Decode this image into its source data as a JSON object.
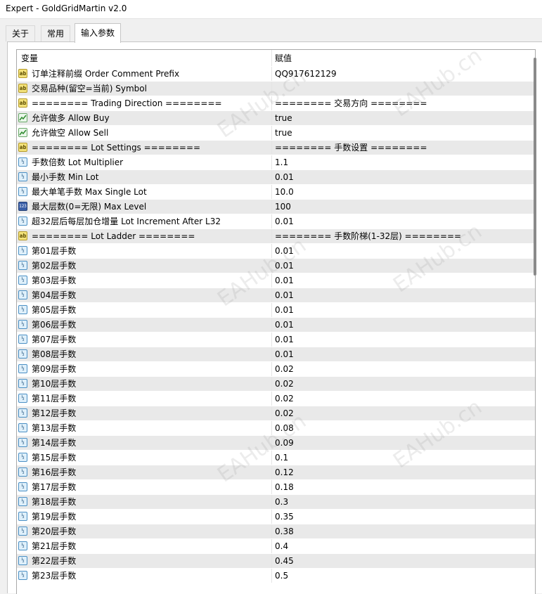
{
  "window": {
    "title": "Expert - GoldGridMartin v2.0"
  },
  "tabs": [
    {
      "label": "关于",
      "active": false
    },
    {
      "label": "常用",
      "active": false
    },
    {
      "label": "输入参数",
      "active": true
    }
  ],
  "table": {
    "headers": {
      "name": "变量",
      "value": "赋值"
    },
    "rows": [
      {
        "icon": "string-icon",
        "name": "订单注释前缀 Order Comment Prefix",
        "value": "QQ917612129"
      },
      {
        "icon": "string-icon",
        "name": "交易品种(留空=当前) Symbol",
        "value": ""
      },
      {
        "icon": "string-icon",
        "name": "======== Trading Direction ========",
        "value": "======== 交易方向 ========"
      },
      {
        "icon": "bool-icon",
        "name": "允许做多 Allow Buy",
        "value": "true"
      },
      {
        "icon": "bool-icon",
        "name": "允许做空 Allow Sell",
        "value": "true"
      },
      {
        "icon": "string-icon",
        "name": "======== Lot Settings ========",
        "value": "======== 手数设置 ========"
      },
      {
        "icon": "double-icon",
        "name": "手数倍数 Lot Multiplier",
        "value": "1.1"
      },
      {
        "icon": "double-icon",
        "name": "最小手数 Min Lot",
        "value": "0.01"
      },
      {
        "icon": "double-icon",
        "name": "最大单笔手数 Max Single Lot",
        "value": "10.0"
      },
      {
        "icon": "int-icon",
        "name": "最大层数(0=无限) Max Level",
        "value": "100"
      },
      {
        "icon": "double-icon",
        "name": "超32层后每层加仓增量 Lot Increment After L32",
        "value": "0.01"
      },
      {
        "icon": "string-icon",
        "name": "======== Lot Ladder ========",
        "value": "======== 手数阶梯(1-32层) ========"
      },
      {
        "icon": "double-icon",
        "name": "第01层手数",
        "value": "0.01"
      },
      {
        "icon": "double-icon",
        "name": "第02层手数",
        "value": "0.01"
      },
      {
        "icon": "double-icon",
        "name": "第03层手数",
        "value": "0.01"
      },
      {
        "icon": "double-icon",
        "name": "第04层手数",
        "value": "0.01"
      },
      {
        "icon": "double-icon",
        "name": "第05层手数",
        "value": "0.01"
      },
      {
        "icon": "double-icon",
        "name": "第06层手数",
        "value": "0.01"
      },
      {
        "icon": "double-icon",
        "name": "第07层手数",
        "value": "0.01"
      },
      {
        "icon": "double-icon",
        "name": "第08层手数",
        "value": "0.01"
      },
      {
        "icon": "double-icon",
        "name": "第09层手数",
        "value": "0.02"
      },
      {
        "icon": "double-icon",
        "name": "第10层手数",
        "value": "0.02"
      },
      {
        "icon": "double-icon",
        "name": "第11层手数",
        "value": "0.02"
      },
      {
        "icon": "double-icon",
        "name": "第12层手数",
        "value": "0.02"
      },
      {
        "icon": "double-icon",
        "name": "第13层手数",
        "value": "0.08"
      },
      {
        "icon": "double-icon",
        "name": "第14层手数",
        "value": "0.09"
      },
      {
        "icon": "double-icon",
        "name": "第15层手数",
        "value": "0.1"
      },
      {
        "icon": "double-icon",
        "name": "第16层手数",
        "value": "0.12"
      },
      {
        "icon": "double-icon",
        "name": "第17层手数",
        "value": "0.18"
      },
      {
        "icon": "double-icon",
        "name": "第18层手数",
        "value": "0.3"
      },
      {
        "icon": "double-icon",
        "name": "第19层手数",
        "value": "0.35"
      },
      {
        "icon": "double-icon",
        "name": "第20层手数",
        "value": "0.38"
      },
      {
        "icon": "double-icon",
        "name": "第21层手数",
        "value": "0.4"
      },
      {
        "icon": "double-icon",
        "name": "第22层手数",
        "value": "0.45"
      },
      {
        "icon": "double-icon",
        "name": "第23层手数",
        "value": "0.5"
      }
    ]
  },
  "watermark": {
    "text": "EAHub.cn"
  },
  "icon_glyphs": {
    "string": "ab",
    "double": "½",
    "int": "123"
  }
}
